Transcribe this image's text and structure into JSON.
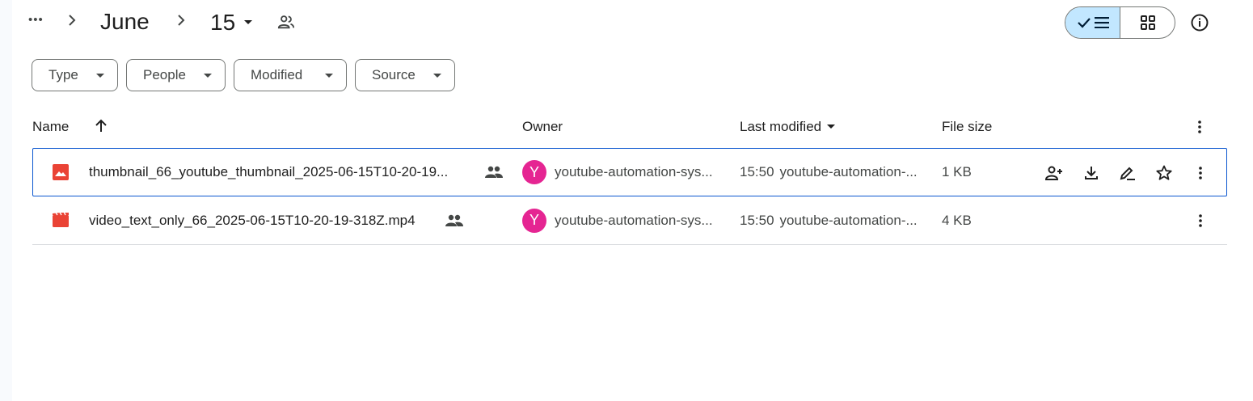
{
  "breadcrumb": {
    "more": "•••",
    "parent": "June",
    "current": "15"
  },
  "filters": [
    "Type",
    "People",
    "Modified",
    "Source"
  ],
  "columns": {
    "name": "Name",
    "owner": "Owner",
    "last_modified": "Last modified",
    "file_size": "File size"
  },
  "files": [
    {
      "name": "thumbnail_66_youtube_thumbnail_2025-06-15T10-20-19...",
      "type_icon": "image-file-icon",
      "shared": true,
      "owner_initial": "Y",
      "owner": "youtube-automation-sys...",
      "modified_time": "15:50",
      "modified_by": "youtube-automation-...",
      "size": "1 KB",
      "selected": true
    },
    {
      "name": "video_text_only_66_2025-06-15T10-20-19-318Z.mp4",
      "type_icon": "video-file-icon",
      "shared": true,
      "owner_initial": "Y",
      "owner": "youtube-automation-sys...",
      "modified_time": "15:50",
      "modified_by": "youtube-automation-...",
      "size": "4 KB",
      "selected": false
    }
  ],
  "colors": {
    "accent": "#0b57d0",
    "toggle_active": "#c2e7ff",
    "avatar": "#e52592",
    "image_icon": "#ea4335",
    "video_icon": "#ea4335"
  }
}
